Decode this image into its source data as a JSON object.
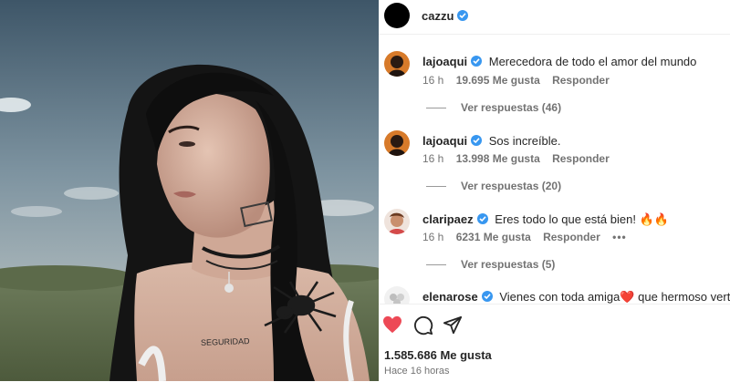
{
  "post": {
    "author": "cazzu",
    "photo_tattoo_text": "SEGURIDAD"
  },
  "comments": [
    {
      "user": "lajoaqui",
      "text": "Merecedora de todo el amor del mundo",
      "time": "16 h",
      "likes": "19.695 Me gusta",
      "reply": "Responder",
      "replies": "Ver respuestas (46)"
    },
    {
      "user": "lajoaqui",
      "text": "Sos increíble.",
      "time": "16 h",
      "likes": "13.998 Me gusta",
      "reply": "Responder",
      "replies": "Ver respuestas (20)"
    },
    {
      "user": "claripaez",
      "text": "Eres todo lo que está bien! 🔥🔥",
      "time": "16 h",
      "likes": "6231 Me gusta",
      "reply": "Responder",
      "more": "•••",
      "replies": "Ver respuestas (5)"
    },
    {
      "user": "elenarose",
      "text": "Vienes con toda amiga❤️ que hermoso verte"
    }
  ],
  "actions": {
    "likes_total": "1.585.686 Me gusta",
    "posted": "Hace 16 horas",
    "like_color": "#ed4956"
  },
  "icons": {
    "verified": "verified-badge-icon",
    "like": "heart-icon",
    "comment": "comment-bubble-icon",
    "share": "share-paper-plane-icon"
  },
  "colors": {
    "verified": "#3897f0",
    "secondary_text": "#737373"
  }
}
